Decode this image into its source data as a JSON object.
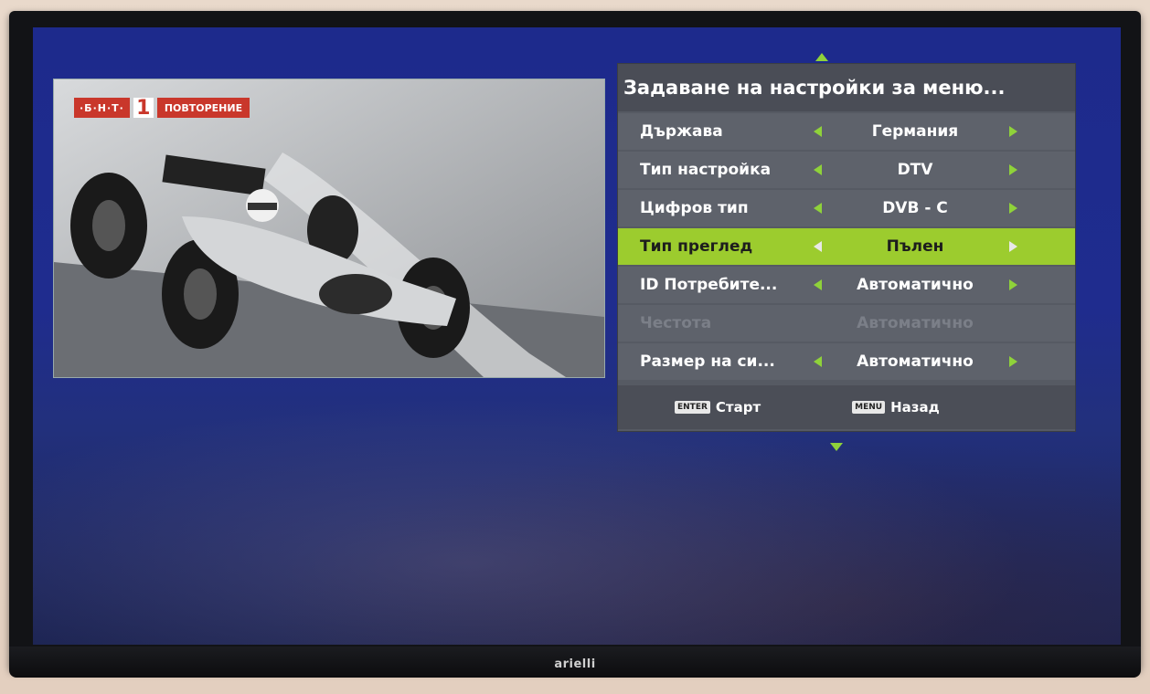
{
  "tv": {
    "brand": "arielli"
  },
  "video": {
    "channel_logo": {
      "bnt": "·Б·Н·Т·",
      "number": "1",
      "tag": "ПОВТОРЕНИЕ"
    }
  },
  "menu": {
    "title": "Задаване на настройки за меню...",
    "rows": [
      {
        "label": "Държава",
        "value": "Германия",
        "state": "normal"
      },
      {
        "label": "Тип настройка",
        "value": "DTV",
        "state": "normal"
      },
      {
        "label": "Цифров тип",
        "value": "DVB - C",
        "state": "normal"
      },
      {
        "label": "Тип преглед",
        "value": "Пълен",
        "state": "selected"
      },
      {
        "label": "ID Потребите...",
        "value": "Автоматично",
        "state": "normal"
      },
      {
        "label": "Честота",
        "value": "Автоматично",
        "state": "disabled"
      },
      {
        "label": "Размер на си...",
        "value": "Автоматично",
        "state": "normal"
      }
    ],
    "footer": {
      "enter_key": "ENTER",
      "enter_label": "Старт",
      "menu_key": "MENU",
      "menu_label": "Назад"
    }
  },
  "colors": {
    "accent_green": "#8fd23a",
    "selected_row": "#9ccc2e",
    "menu_panel": "#565a63",
    "screen_blue": "#1f2c8e"
  }
}
